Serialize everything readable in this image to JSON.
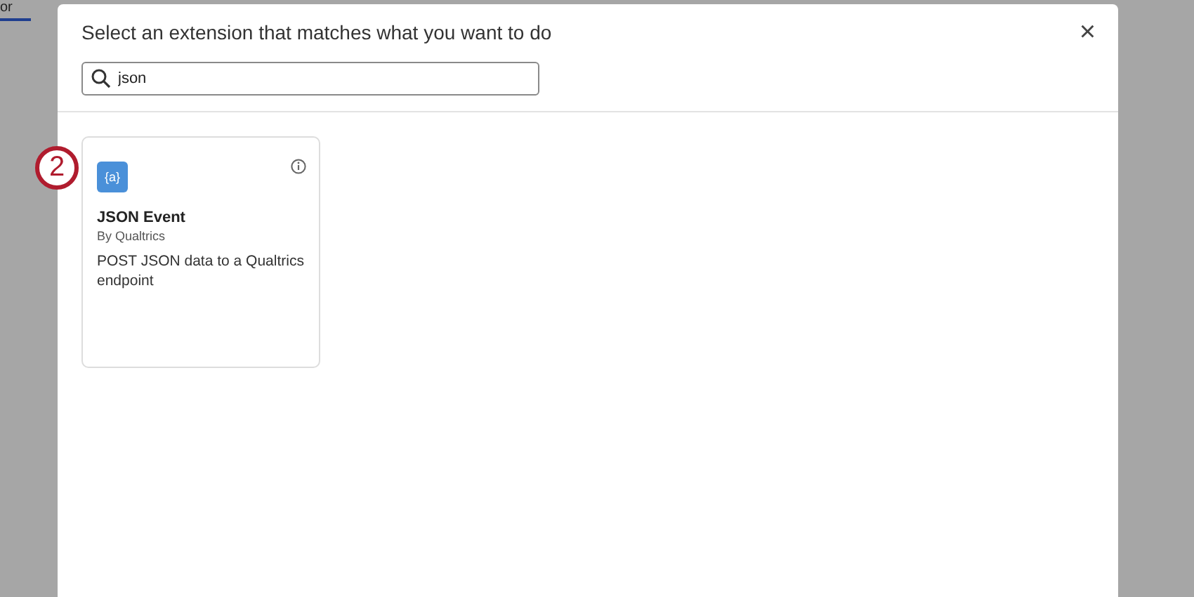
{
  "background_tabs": [
    {
      "label": "or",
      "selected": true
    }
  ],
  "dialog": {
    "title": "Select an extension that matches what you want to do",
    "close": "×",
    "search": {
      "value": "json"
    }
  },
  "extensions": [
    {
      "icon": "{a}",
      "name": "JSON Event",
      "author": "By Qualtrics",
      "description": "POST JSON data to a Qualtrics endpoint"
    }
  ],
  "step_marker": "2"
}
